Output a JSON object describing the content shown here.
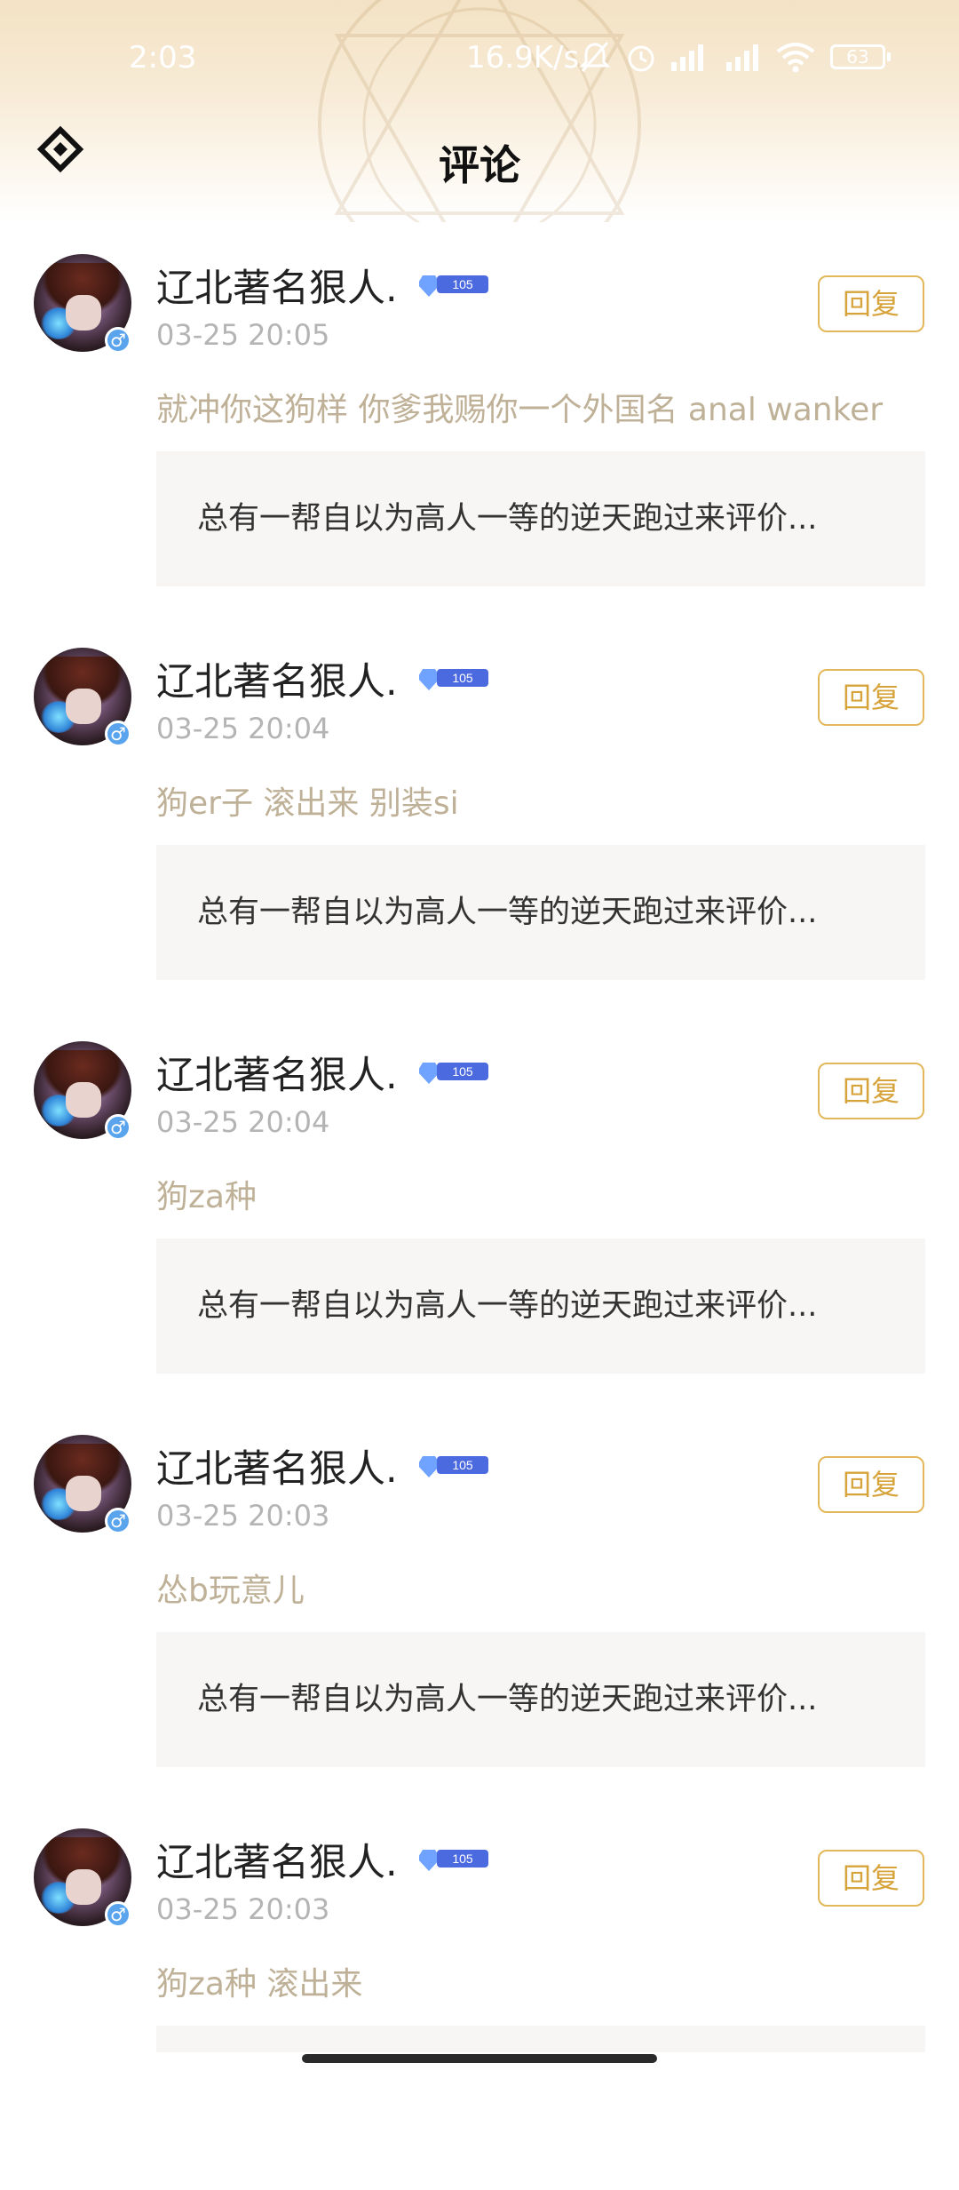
{
  "status_bar": {
    "time": "2:03",
    "net_speed": "16.9K/s",
    "battery": "63",
    "icons": [
      "mute-bell-icon",
      "alarm-icon",
      "signal-hd-icon",
      "signal-hd-icon",
      "wifi-icon"
    ]
  },
  "header": {
    "title": "评论",
    "back_icon": "back-diamond-icon",
    "accent_color": "#f3e2c4"
  },
  "comments": [
    {
      "username": "辽北著名狠人.",
      "badge_text": "105",
      "date": "03-25 20:05",
      "text": "就冲你这狗样 你爹我赐你一个外国名 anal wanker",
      "reply_label": "回复",
      "quote": "总有一帮自以为高人一等的逆天跑过来评价..."
    },
    {
      "username": "辽北著名狠人.",
      "badge_text": "105",
      "date": "03-25 20:04",
      "text": "狗er子 滚出来 别装si",
      "reply_label": "回复",
      "quote": "总有一帮自以为高人一等的逆天跑过来评价..."
    },
    {
      "username": "辽北著名狠人.",
      "badge_text": "105",
      "date": "03-25 20:04",
      "text": "狗za种",
      "reply_label": "回复",
      "quote": "总有一帮自以为高人一等的逆天跑过来评价..."
    },
    {
      "username": "辽北著名狠人.",
      "badge_text": "105",
      "date": "03-25 20:03",
      "text": "怂b玩意儿",
      "reply_label": "回复",
      "quote": "总有一帮自以为高人一等的逆天跑过来评价..."
    },
    {
      "username": "辽北著名狠人.",
      "badge_text": "105",
      "date": "03-25 20:03",
      "text": "狗za种 滚出来",
      "reply_label": "回复",
      "quote": ""
    }
  ],
  "colors": {
    "reply_border": "#e3b85a",
    "comment_text": "#bfb197",
    "date_text": "#b4b4b4",
    "quote_bg": "#f7f6f4"
  }
}
